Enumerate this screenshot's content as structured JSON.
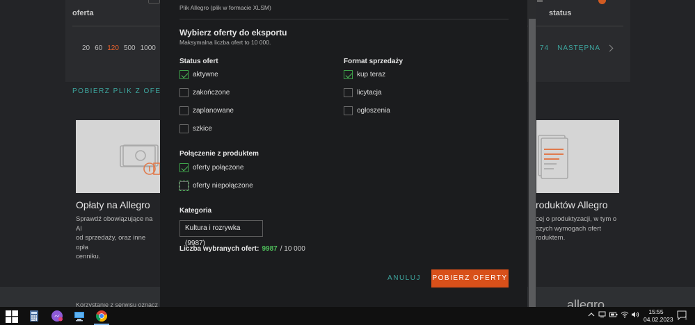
{
  "background": {
    "column_left": "oferta",
    "column_right": "status",
    "page_sizes": [
      "20",
      "60",
      "120",
      "500",
      "1000"
    ],
    "active_page_size": "120",
    "pager_number": "74",
    "pager_next": "NASTĘPNA",
    "download_link": "POBIERZ PLIK Z OFERTA",
    "card_left_title": "Opłaty na Allegro",
    "card_left_lines": [
      "Sprawdź obowiązujące na Al",
      "od sprzedaży, oraz inne opła",
      "cenniku."
    ],
    "card_right_title": "roduktów Allegro",
    "card_right_lines": [
      "cej o produktyzacji, w tym o",
      "szych wymogach ofert",
      "roduktem."
    ],
    "footer_text": "Korzystanie z serwisu oznacz",
    "footer_logo": "allegro"
  },
  "modal": {
    "file_type_subtitle": "Plik Allegro (plik w formacie XLSM)",
    "section_title": "Wybierz oferty do eksportu",
    "max_note": "Maksymalna liczba ofert to 10 000.",
    "status_label": "Status ofert",
    "status_options": [
      {
        "label": "aktywne",
        "checked": true
      },
      {
        "label": "zakończone",
        "checked": false
      },
      {
        "label": "zaplanowane",
        "checked": false
      },
      {
        "label": "szkice",
        "checked": false
      }
    ],
    "format_label": "Format sprzedaży",
    "format_options": [
      {
        "label": "kup teraz",
        "checked": true
      },
      {
        "label": "licytacja",
        "checked": false
      },
      {
        "label": "ogłoszenia",
        "checked": false
      }
    ],
    "product_label": "Połączenie z produktem",
    "product_options": [
      {
        "label": "oferty połączone",
        "checked": true
      },
      {
        "label": "oferty niepołączone",
        "checked": false
      }
    ],
    "category_label": "Kategoria",
    "category_value": "Kultura i rozrywka (9987)",
    "count_label": "Liczba wybranych ofert:",
    "count_value": "9987",
    "count_total": "/ 10 000",
    "cancel_label": "ANULUJ",
    "submit_label": "POBIERZ OFERTY"
  },
  "taskbar": {
    "time": "15:55",
    "date": "04.02.2023",
    "notification_count": "1"
  },
  "colors": {
    "accent_orange": "#d8501a",
    "accent_teal": "#3ea7a0",
    "check_green": "#4fbf5b"
  }
}
